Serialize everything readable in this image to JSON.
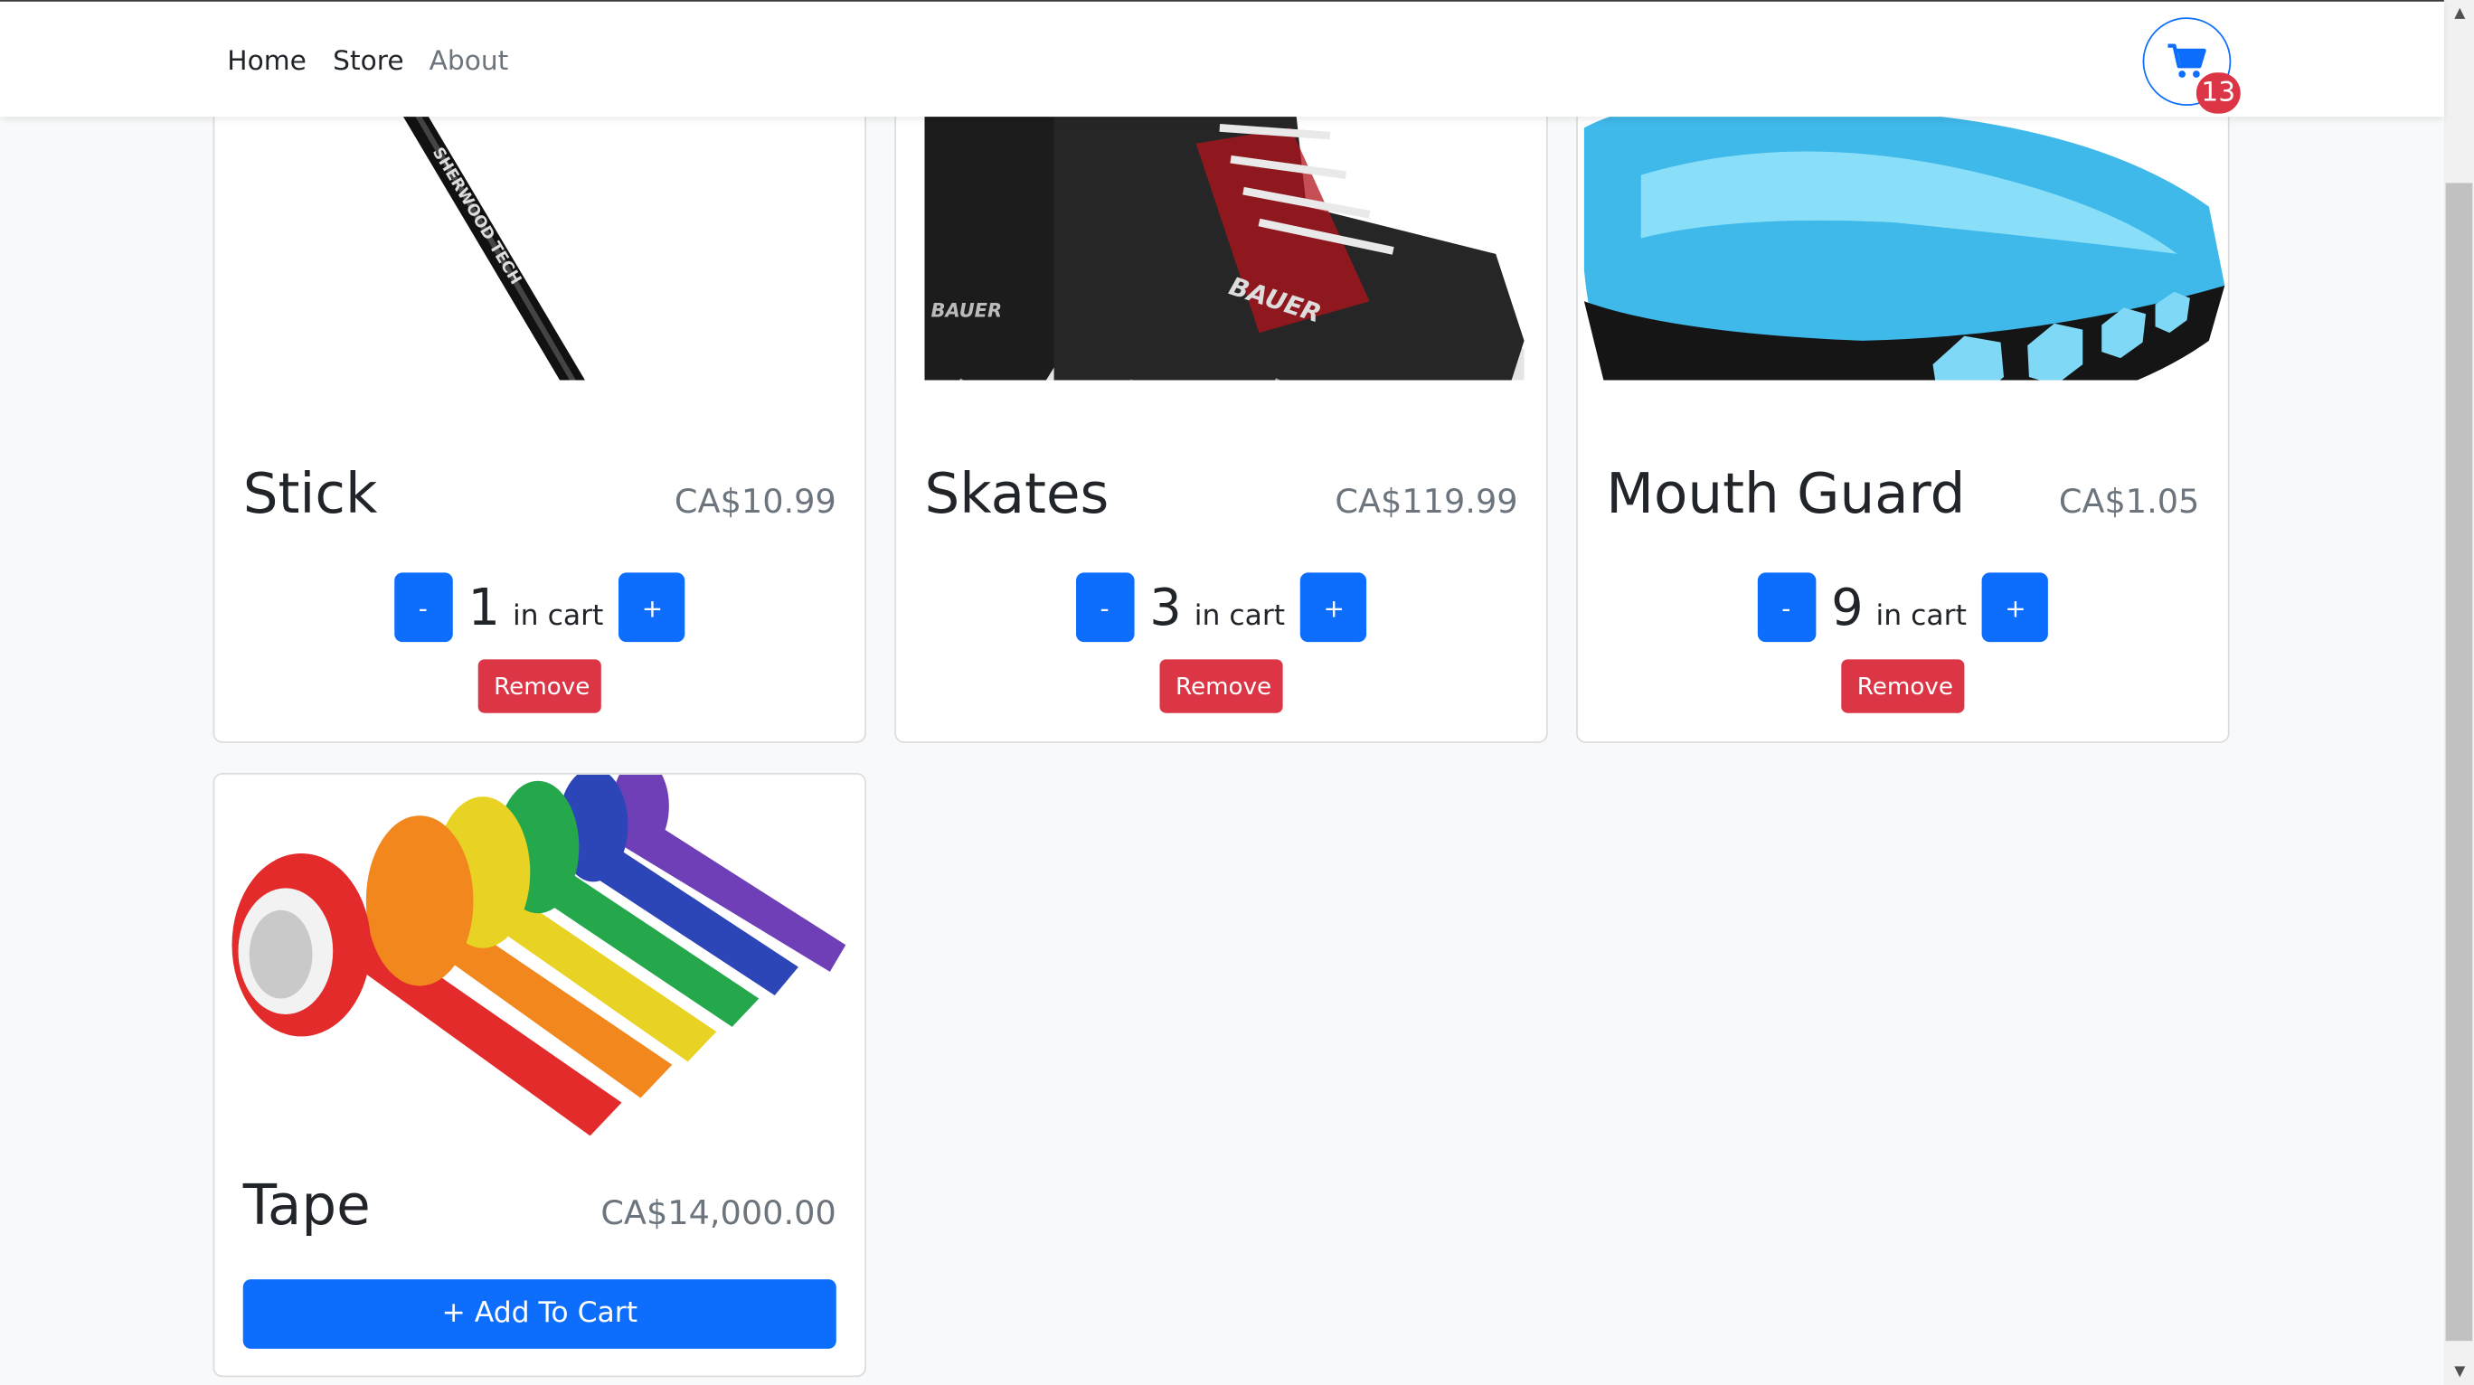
{
  "nav": {
    "links": [
      "Home",
      "Store",
      "About"
    ],
    "cart_count": "13"
  },
  "products": [
    {
      "name": "Stick",
      "price": "CA$10.99",
      "quantity": "1",
      "in_cart_label": "in cart",
      "decrement": "-",
      "increment": "+",
      "remove_label": "Remove"
    },
    {
      "name": "Skates",
      "price": "CA$119.99",
      "quantity": "3",
      "in_cart_label": "in cart",
      "decrement": "-",
      "increment": "+",
      "remove_label": "Remove"
    },
    {
      "name": "Mouth Guard",
      "price": "CA$1.05",
      "quantity": "9",
      "in_cart_label": "in cart",
      "decrement": "-",
      "increment": "+",
      "remove_label": "Remove"
    },
    {
      "name": "Tape",
      "price": "CA$14,000.00",
      "add_label": "+ Add To Cart"
    }
  ],
  "colors": {
    "primary": "#0d6efd",
    "danger": "#dc3545",
    "muted": "#6c757d",
    "background": "#f8f9fa"
  }
}
